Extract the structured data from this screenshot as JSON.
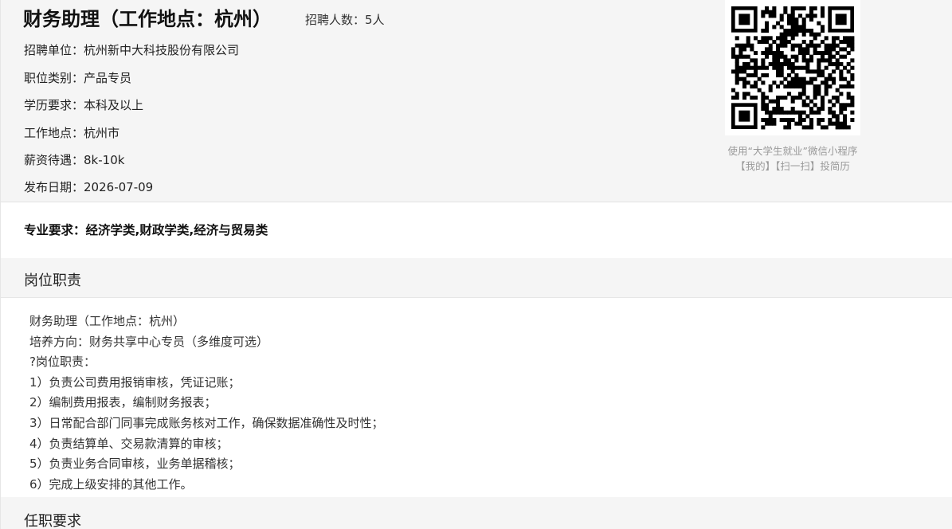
{
  "header": {
    "title": "财务助理（工作地点：杭州）",
    "headcount": "招聘人数：5人",
    "info": [
      {
        "label": "招聘单位：",
        "value": "杭州新中大科技股份有限公司"
      },
      {
        "label": "职位类别：",
        "value": "产品专员"
      },
      {
        "label": "学历要求：",
        "value": "本科及以上"
      },
      {
        "label": "工作地点：",
        "value": "杭州市"
      },
      {
        "label": "薪资待遇：",
        "value": "8k-10k"
      },
      {
        "label": "发布日期：",
        "value": "2026-07-09"
      }
    ]
  },
  "qr": {
    "caption_line1": "使用“大学生就业”微信小程序",
    "caption_line2": "【我的】【扫一扫】投简历"
  },
  "major": "专业要求：经济学类,财政学类,经济与贸易类",
  "duties": {
    "section_title": "岗位职责",
    "lines": [
      "财务助理（工作地点：杭州）",
      "培养方向：财务共享中心专员（多维度可选）",
      "?岗位职责：",
      "1）负责公司费用报销审核，凭证记账；",
      "2）编制费用报表，编制财务报表；",
      "3）日常配合部门同事完成账务核对工作，确保数据准确性及时性；",
      "4）负责结算单、交易款清算的审核；",
      "5）负责业务合同审核，业务单据稽核；",
      "6）完成上级安排的其他工作。"
    ]
  },
  "requirements": {
    "section_title": "任职要求"
  },
  "colors": {
    "header_bg": "#f5f5f5",
    "caption": "#999999",
    "text": "#222222"
  }
}
